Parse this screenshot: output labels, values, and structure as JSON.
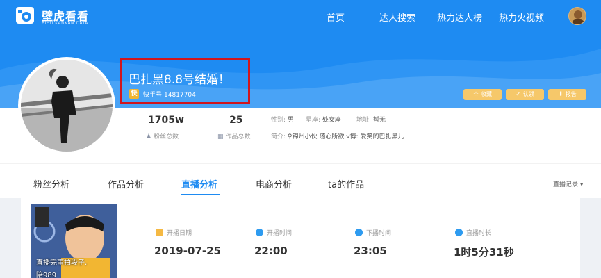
{
  "header": {
    "logo_title": "壁虎看看",
    "logo_sub": "BIHU KANKAN DATA",
    "nav": [
      "首页",
      "达人搜索",
      "热力达人榜",
      "热力火视频"
    ]
  },
  "profile": {
    "name": "巴扎黑8.8号结婚！",
    "kuaishou_id": "快手号:14817704",
    "actions": [
      "收藏",
      "认领",
      "报告"
    ],
    "fans_value": "1705w",
    "fans_label": "粉丝总数",
    "works_value": "25",
    "works_label": "作品总数",
    "gender_label": "性别:",
    "gender": "男",
    "zodiac_label": "星座:",
    "zodiac": "处女座",
    "region_label": "地址:",
    "region": "暂无",
    "bio_label": "简介:",
    "bio": "♀锦州小伙 随心所欲 v博: 爱笑的巴扎黑儿"
  },
  "tabs": {
    "items": [
      "粉丝分析",
      "作品分析",
      "直播分析",
      "电商分析",
      "ta的作品"
    ],
    "active_index": 2,
    "live_record": "直播记录 ▾"
  },
  "live": {
    "thumb_caption": "直播完事拍段子,",
    "thumb_caption2": "陪989",
    "fields": [
      {
        "label": "开播日期",
        "value": "2019-07-25",
        "icon_color": "#f5b944",
        "icon": "calendar-icon"
      },
      {
        "label": "开播时间",
        "value": "22:00",
        "icon_color": "#2e9bf0",
        "icon": "play-icon"
      },
      {
        "label": "下播时间",
        "value": "23:05",
        "icon_color": "#2e9bf0",
        "icon": "stop-icon"
      },
      {
        "label": "直播时长",
        "value": "1时5分31秒",
        "icon_color": "#2e9bf0",
        "icon": "clock-icon"
      }
    ]
  },
  "colors": {
    "brand_blue": "#1e8bf2",
    "highlight_red": "#d0151d",
    "action_gold": "#f6c86a"
  }
}
